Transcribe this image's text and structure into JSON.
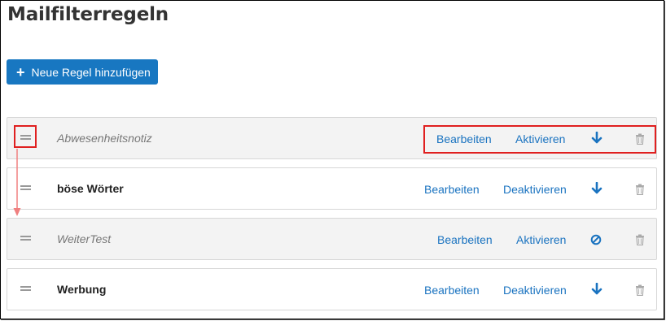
{
  "page": {
    "title": "Mailfilterregeln"
  },
  "toolbar": {
    "add_rule_label": "Neue Regel hinzufügen",
    "add_icon": "plus-icon"
  },
  "colors": {
    "accent": "#1877c1",
    "link": "#1a73c0",
    "highlight": "#e02020"
  },
  "rules": [
    {
      "name": "Abwesenheitsnotiz",
      "state": "inactive",
      "edit_label": "Bearbeiten",
      "toggle_label": "Aktivieren",
      "order_icon": "arrow-down-icon",
      "delete_icon": "trash-icon"
    },
    {
      "name": "böse Wörter",
      "state": "active",
      "edit_label": "Bearbeiten",
      "toggle_label": "Deaktivieren",
      "order_icon": "arrow-down-icon",
      "delete_icon": "trash-icon"
    },
    {
      "name": "WeiterTest",
      "state": "inactive",
      "edit_label": "Bearbeiten",
      "toggle_label": "Aktivieren",
      "order_icon": "no-entry-icon",
      "delete_icon": "trash-icon"
    },
    {
      "name": "Werbung",
      "state": "active",
      "edit_label": "Bearbeiten",
      "toggle_label": "Deaktivieren",
      "order_icon": "arrow-down-icon",
      "delete_icon": "trash-icon"
    }
  ]
}
